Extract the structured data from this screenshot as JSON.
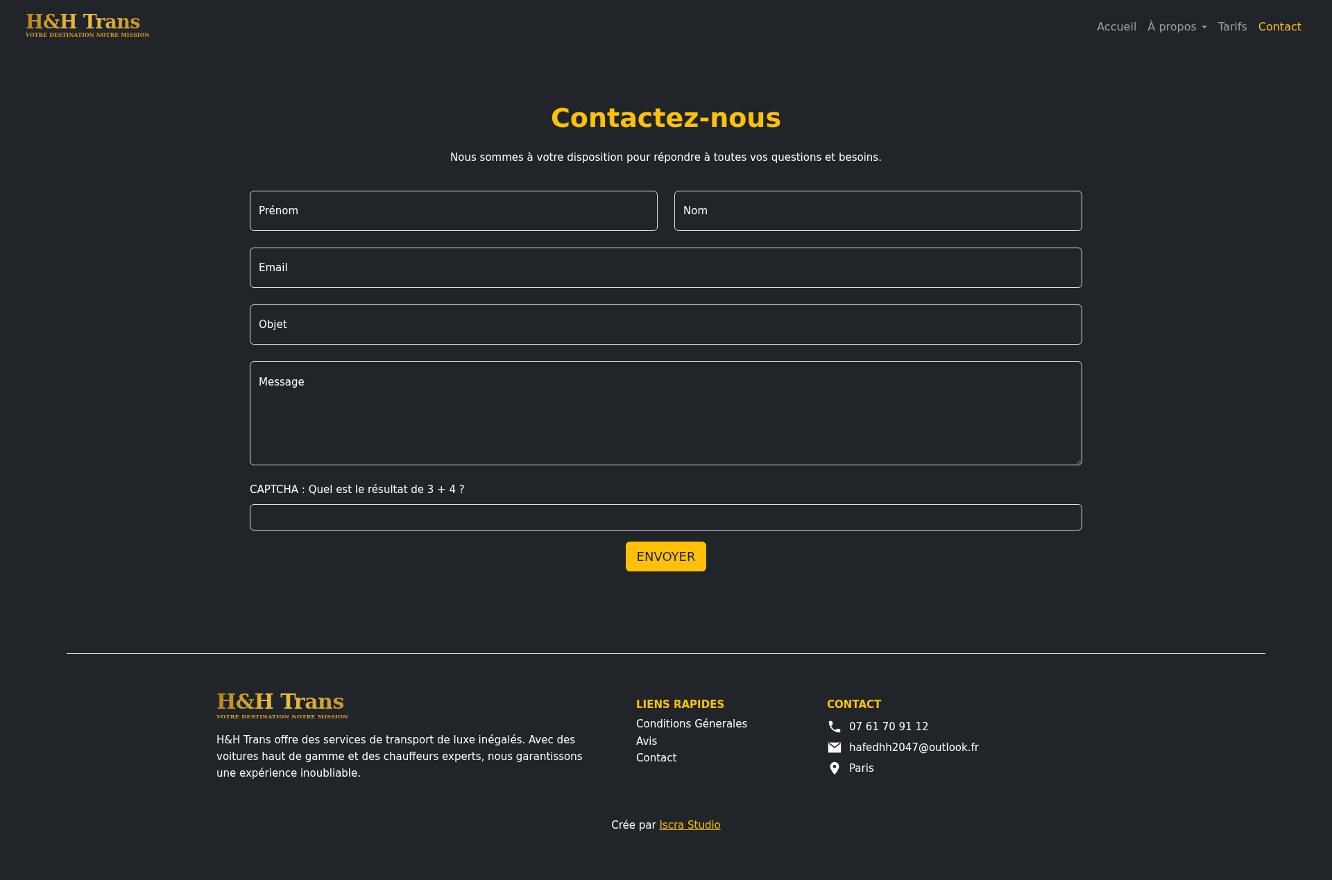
{
  "brand": {
    "name": "H&H Trans",
    "tagline": "VOTRE DESTINATION NOTRE MISSION"
  },
  "nav": [
    {
      "label": "Accueil",
      "selected": false,
      "kind": "link"
    },
    {
      "label": "À propos",
      "selected": false,
      "kind": "dropdown"
    },
    {
      "label": "Tarifs",
      "selected": false,
      "kind": "link"
    },
    {
      "label": "Contact",
      "selected": true,
      "kind": "link"
    }
  ],
  "heading": "Contactez-nous",
  "intro": "Nous sommes à votre disposition pour répondre à toutes vos questions et besoins.",
  "form": {
    "first_name": {
      "placeholder": "Prénom"
    },
    "last_name": {
      "placeholder": "Nom"
    },
    "email": {
      "placeholder": "Email"
    },
    "subject": {
      "placeholder": "Objet"
    },
    "message": {
      "placeholder": "Message"
    },
    "captcha_label": "CAPTCHA : Quel est le résultat de 3 + 4 ?",
    "submit": "ENVOYER"
  },
  "footer": {
    "brand": {
      "name": "H&H Trans",
      "tagline": "VOTRE DESTINATION NOTRE MISSION"
    },
    "about": "H&H Trans offre des services de transport de luxe inégalés. Avec des voitures haut de gamme et des chauffeurs experts, nous garantissons une expérience inoubliable.",
    "links_title": "LIENS RAPIDES",
    "links": [
      "Conditions Génerales",
      "Avis",
      "Contact"
    ],
    "contact_title": "CONTACT",
    "contact": [
      {
        "kind": "phone",
        "text": "07 61 70 91 12"
      },
      {
        "kind": "email",
        "text": "hafedhh2047@outlook.fr"
      },
      {
        "kind": "location",
        "text": "Paris"
      }
    ],
    "credit": {
      "text": "Crée par",
      "link": "Iscra Studio"
    }
  }
}
